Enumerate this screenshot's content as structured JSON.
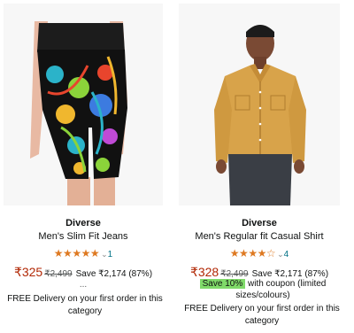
{
  "products": [
    {
      "brand": "Diverse",
      "title": "Men's Slim Fit Jeans",
      "stars_glyphs": "★★★★★",
      "stars_value": 5,
      "chevron": "⌄",
      "rating_count": "1",
      "price": "₹325",
      "mrp": "₹2,499",
      "savings": "Save ₹2,174 (87%)",
      "more": "...",
      "delivery": "FREE Delivery on your first order in this category",
      "image_icon": "leggings-icon"
    },
    {
      "brand": "Diverse",
      "title": "Men's Regular fit Casual Shirt",
      "stars_glyphs": "★★★★☆",
      "stars_value": 4,
      "chevron": "⌄",
      "rating_count": "4",
      "price": "₹328",
      "mrp": "₹2,499",
      "savings": "Save ₹2,171 (87%)",
      "coupon_badge": "Save 10%",
      "coupon_text": " with coupon (limited sizes/colours)",
      "delivery": "FREE Delivery on your first order in this category",
      "image_icon": "shirt-icon"
    }
  ],
  "colors": {
    "price": "#b12704",
    "stars": "#de7921",
    "link": "#007185",
    "coupon": "#7fda69",
    "image_bg": "#f7f7f7"
  }
}
